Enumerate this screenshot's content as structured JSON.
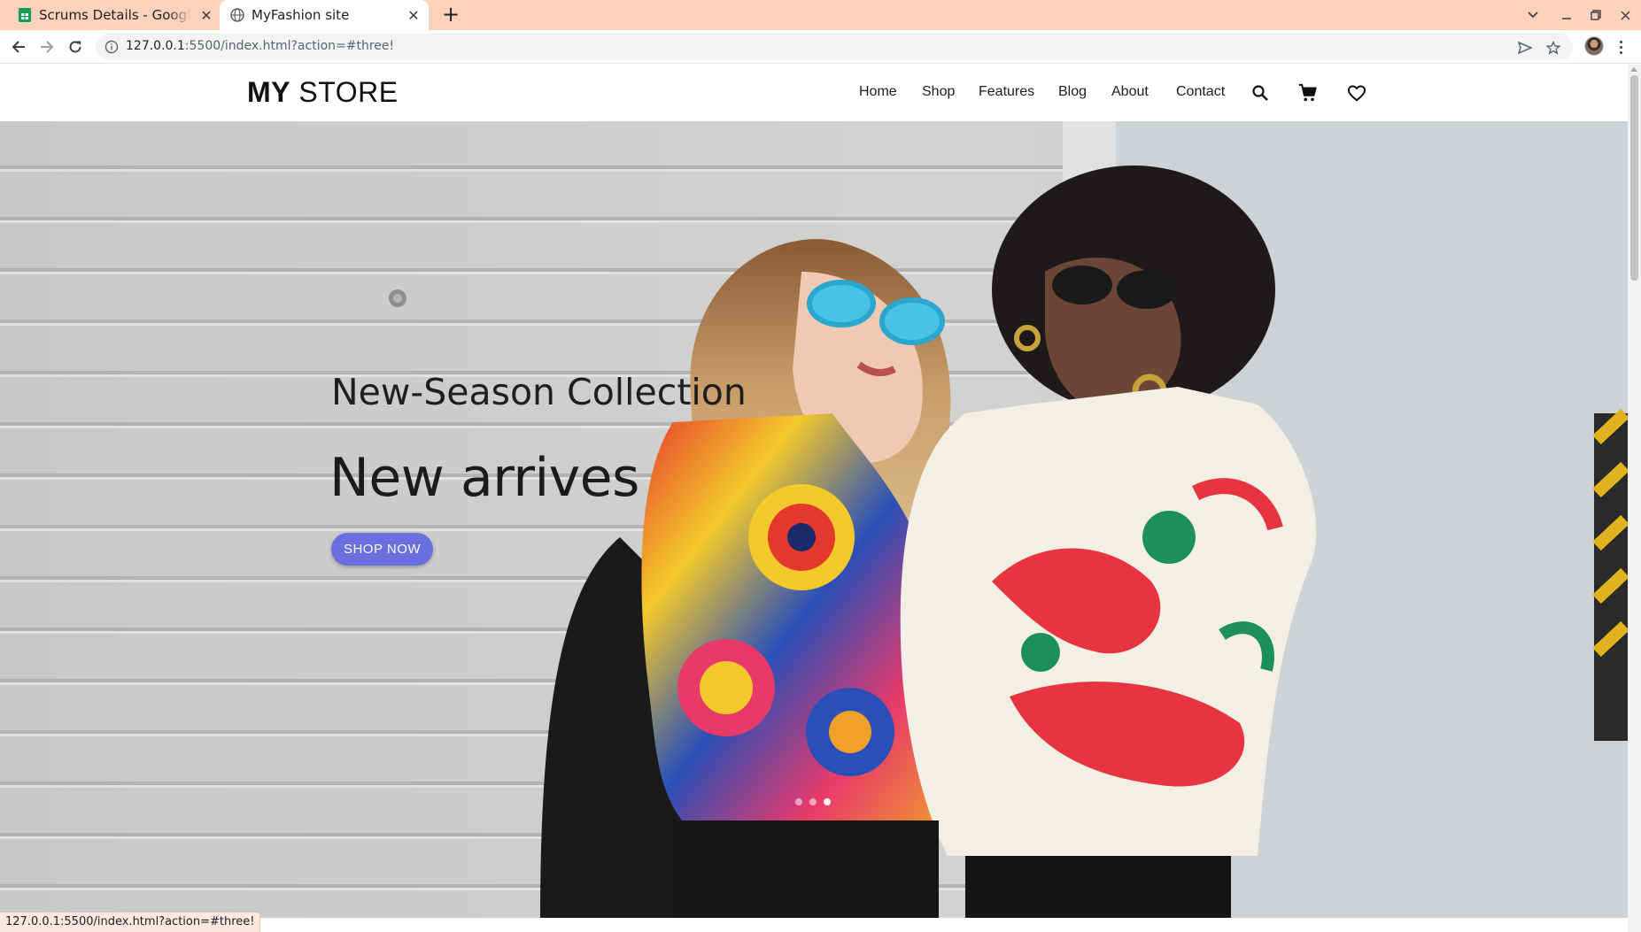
{
  "browser": {
    "tabs": [
      {
        "title": "Scrums Details - Google Sheets",
        "icon": "google-sheets-icon"
      },
      {
        "title": "MyFashion site",
        "icon": "globe-icon"
      }
    ],
    "url_host": "127.0.0.1",
    "url_rest": ":5500/index.html?action=#three!",
    "status_url": "127.0.0.1:5500/index.html?action=#three!"
  },
  "site": {
    "logo_bold": "MY",
    "logo_rest": "STORE",
    "nav": [
      "Home",
      "Shop",
      "Features",
      "Blog",
      "About",
      "Contact"
    ],
    "nav_icons": [
      "search-icon",
      "cart-icon",
      "heart-icon"
    ]
  },
  "hero": {
    "subtitle": "New-Season Collection",
    "title": "New arrives",
    "button_label": "SHOP NOW",
    "slides_total": 3,
    "active_slide": 3
  },
  "colors": {
    "tabbar": "#fcd2bd",
    "button": "#6a6fe0",
    "page_bg": "#ffffff"
  }
}
